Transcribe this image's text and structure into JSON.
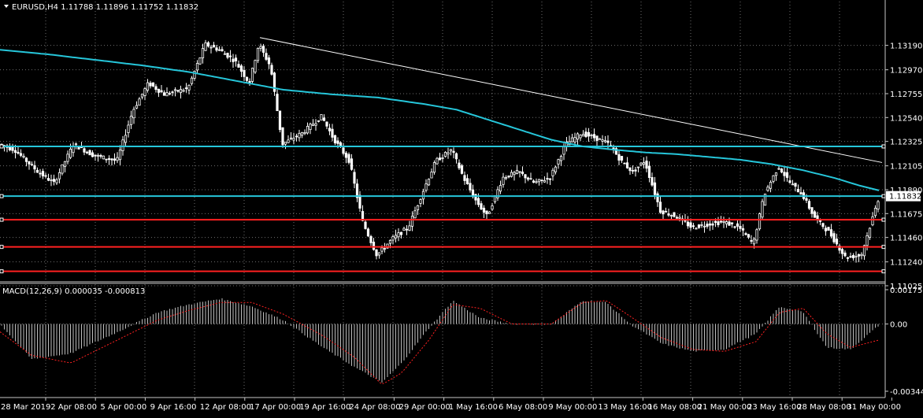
{
  "colors": {
    "background": "#000000",
    "grid": "#c8c8c8",
    "candle": "#ffffff",
    "ma": "#26c6da",
    "support": "#ff2020",
    "hline_cyan": "#26c6da",
    "trendline": "#ffffff",
    "macd_hist": "#c0c0c0",
    "macd_signal": "#ff2020",
    "text": "#ffffff",
    "price_tag_bg": "#ffffff",
    "price_tag_text": "#000000"
  },
  "header": {
    "symbol_line": "EURUSD,H4  1.11788 1.11896 1.11752 1.11832"
  },
  "macd": {
    "label": "MACD(12,26,9) 0.000035 -0.000813",
    "ylim": [
      -0.003441,
      0.001757
    ],
    "tick_labels": [
      "0.001757",
      "0.00",
      "-0.003441"
    ],
    "anchors_x": [
      0,
      40,
      90,
      150,
      200,
      240,
      280,
      320,
      360,
      410,
      450,
      485,
      510,
      545,
      575,
      610,
      650,
      700,
      740,
      770,
      800,
      840,
      880,
      920,
      960,
      990,
      1020,
      1050,
      1080,
      1118
    ],
    "anchors_hist": [
      0,
      -0.0018,
      -0.0015,
      -0.0004,
      0.0006,
      0.001,
      0.0013,
      0.0009,
      0.0002,
      -0.0012,
      -0.0022,
      -0.003,
      -0.002,
      -0.0002,
      0.0012,
      0.0003,
      0.0,
      0.0,
      0.0012,
      0.0011,
      0.0,
      -0.001,
      -0.0014,
      -0.0013,
      -0.0005,
      0.0009,
      0.0006,
      -0.0012,
      -0.0013,
      0.0
    ],
    "anchors_signal": [
      -0.0004,
      -0.0016,
      -0.002,
      -0.0008,
      0.0002,
      0.0007,
      0.0011,
      0.0011,
      0.0005,
      -0.0006,
      -0.0017,
      -0.0031,
      -0.0025,
      -0.0008,
      0.001,
      0.0008,
      0.0,
      0.0,
      0.0011,
      0.0012,
      0.0004,
      -0.0007,
      -0.0013,
      -0.0014,
      -0.0009,
      0.0006,
      0.0008,
      -0.0005,
      -0.0012,
      -0.0008
    ]
  },
  "chart_data": {
    "type": "candlestick",
    "symbol": "EURUSD",
    "timeframe": "H4",
    "ohlc_current": {
      "open": 1.11788,
      "high": 1.11896,
      "low": 1.11752,
      "close": 1.11832
    },
    "ylim": [
      1.11025,
      1.134
    ],
    "y_ticks": [
      1.1319,
      1.1297,
      1.12755,
      1.1254,
      1.12325,
      1.12105,
      1.1189,
      1.11675,
      1.1146,
      1.1124,
      1.11025
    ],
    "y_tick_labels": [
      "1.13190",
      "1.12970",
      "1.12755",
      "1.12540",
      "1.12325",
      "1.12105",
      "1.11890",
      "1.11675",
      "1.11460",
      "1.11240",
      "1.11025"
    ],
    "current_price_label": "1.11832",
    "current_price": 1.11832,
    "x_labels": [
      "28 Mar 2019",
      "2 Apr 08:00",
      "5 Apr 00:00",
      "9 Apr 16:00",
      "12 Apr 08:00",
      "17 Apr 00:00",
      "19 Apr 16:00",
      "24 Apr 08:00",
      "29 Apr 00:00",
      "1 May 16:00",
      "6 May 08:00",
      "9 May 00:00",
      "13 May 16:00",
      "16 May 08:00",
      "21 May 00:00",
      "23 May 16:00",
      "28 May 08:00",
      "31 May 00:00"
    ],
    "horizontal_lines": [
      {
        "price": 1.1228,
        "color": "cyan"
      },
      {
        "price": 1.11832,
        "color": "cyan"
      },
      {
        "price": 1.1162,
        "color": "red"
      },
      {
        "price": 1.11375,
        "color": "red"
      },
      {
        "price": 1.11155,
        "color": "red"
      }
    ],
    "trendline": {
      "from": {
        "bar_x": 330,
        "price": 1.1326
      },
      "to": {
        "bar_x": 1120,
        "price": 1.12135
      }
    },
    "moving_average": {
      "anchors_x": [
        0,
        60,
        120,
        180,
        240,
        300,
        360,
        420,
        480,
        540,
        580,
        620,
        660,
        700,
        740,
        780,
        820,
        860,
        900,
        940,
        980,
        1020,
        1060,
        1090,
        1118
      ],
      "prices": [
        1.1315,
        1.1311,
        1.1306,
        1.1301,
        1.1295,
        1.1287,
        1.1279,
        1.1275,
        1.1272,
        1.1266,
        1.1261,
        1.1252,
        1.1243,
        1.1234,
        1.1228,
        1.1225,
        1.12225,
        1.1221,
        1.12185,
        1.1216,
        1.1212,
        1.12065,
        1.11995,
        1.1193,
        1.1188
      ]
    },
    "price_path": {
      "anchors_x": [
        0,
        20,
        50,
        70,
        95,
        120,
        150,
        170,
        190,
        210,
        240,
        262,
        280,
        300,
        318,
        330,
        345,
        360,
        385,
        410,
        425,
        445,
        462,
        480,
        500,
        520,
        540,
        555,
        575,
        590,
        605,
        620,
        640,
        660,
        680,
        700,
        720,
        740,
        760,
        775,
        790,
        805,
        820,
        840,
        860,
        880,
        900,
        920,
        940,
        958,
        972,
        990,
        1005,
        1020,
        1035,
        1055,
        1075,
        1095,
        1110,
        1118
      ],
      "prices": [
        1.123,
        1.1225,
        1.1205,
        1.1195,
        1.123,
        1.122,
        1.1215,
        1.126,
        1.1285,
        1.1275,
        1.128,
        1.132,
        1.1315,
        1.1305,
        1.1285,
        1.132,
        1.13,
        1.123,
        1.124,
        1.1255,
        1.1235,
        1.1215,
        1.116,
        1.113,
        1.1145,
        1.1155,
        1.119,
        1.1215,
        1.1225,
        1.12,
        1.118,
        1.1165,
        1.12,
        1.1205,
        1.1195,
        1.12,
        1.123,
        1.124,
        1.1235,
        1.123,
        1.1215,
        1.1205,
        1.1215,
        1.117,
        1.1165,
        1.1155,
        1.1158,
        1.116,
        1.1155,
        1.114,
        1.1185,
        1.121,
        1.1195,
        1.1185,
        1.1165,
        1.115,
        1.1128,
        1.113,
        1.1165,
        1.11832
      ]
    }
  }
}
